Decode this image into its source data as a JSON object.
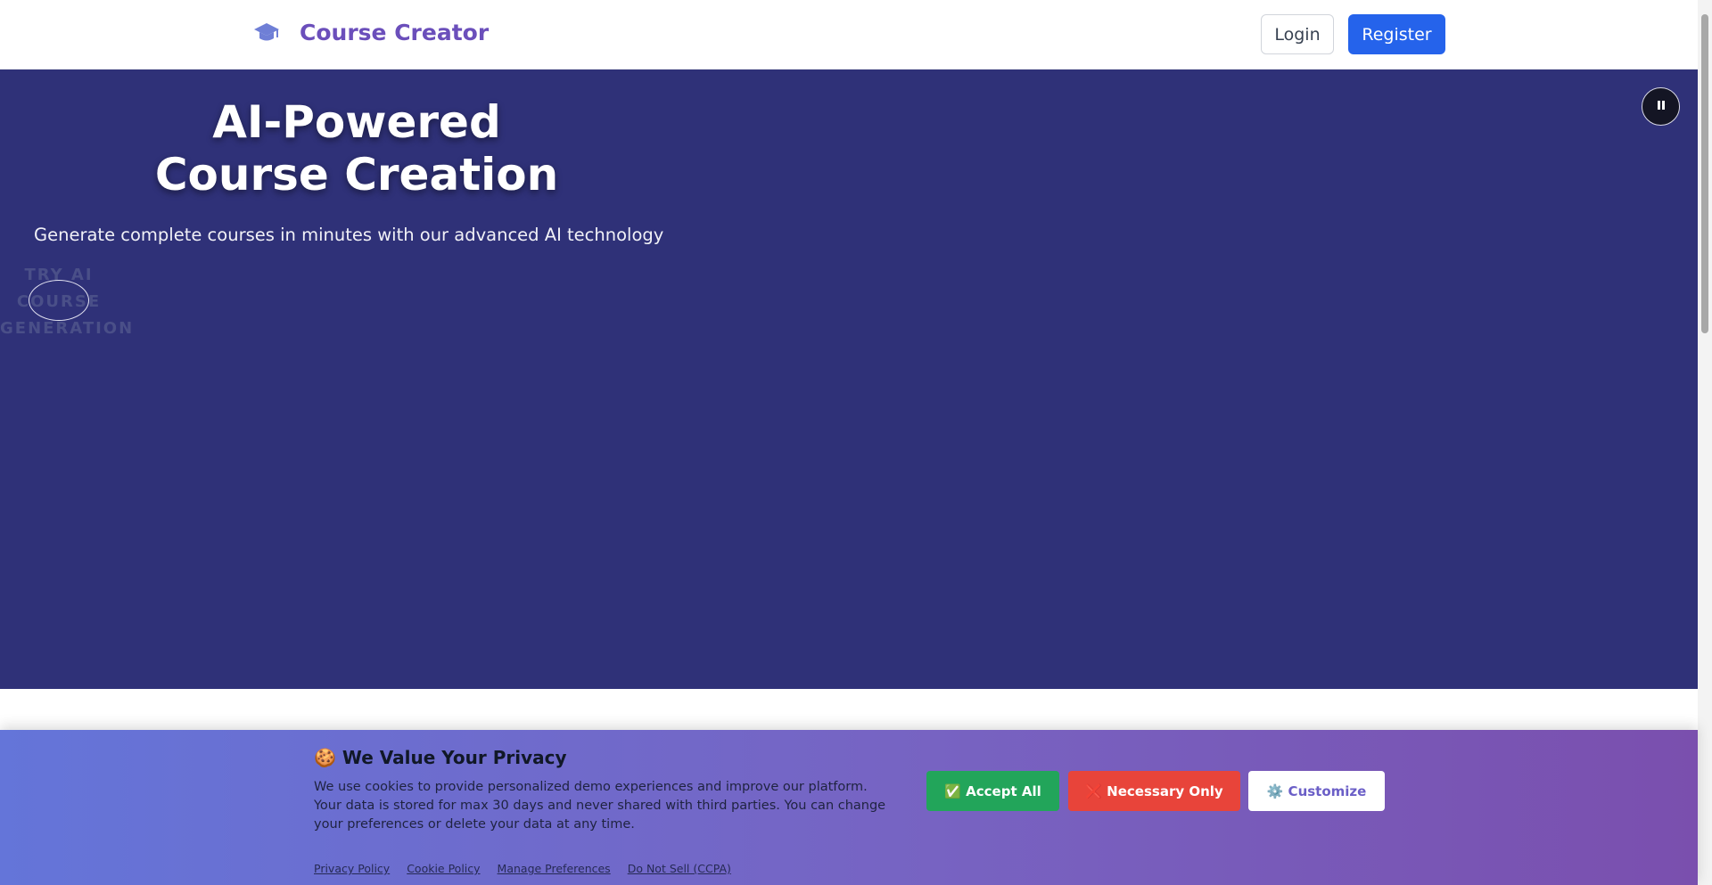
{
  "navbar": {
    "brand_icon": "graduation-cap-icon",
    "brand_name": "Course Creator",
    "login_label": "Login",
    "register_label": "Register"
  },
  "hero": {
    "title_line1": "AI-Powered",
    "title_line2": "Course Creation",
    "subtitle": "Generate complete courses in minutes with our advanced AI technology",
    "cta_line1": "TRY AI",
    "cta_line2": "COURSE",
    "cta_line3": "GENERATION",
    "pause_icon": "pause-icon"
  },
  "cookie_banner": {
    "title": "🍪 We Value Your Privacy",
    "text": "We use cookies to provide personalized demo experiences and improve our platform. Your data is stored for max 30 days and never shared with third parties. You can change your preferences or delete your data at any time.",
    "accept_label": "✅ Accept All",
    "necessary_label": "❌ Necessary Only",
    "customize_label": "⚙️ Customize",
    "links": [
      "Privacy Policy",
      "Cookie Policy",
      "Manage Preferences",
      "Do Not Sell (CCPA)"
    ]
  },
  "colors": {
    "brand": "#6b4fbb",
    "primary": "#2563eb",
    "hero_bg": "#2f3178",
    "accept": "#22a55a",
    "necessary": "#e8443a"
  }
}
